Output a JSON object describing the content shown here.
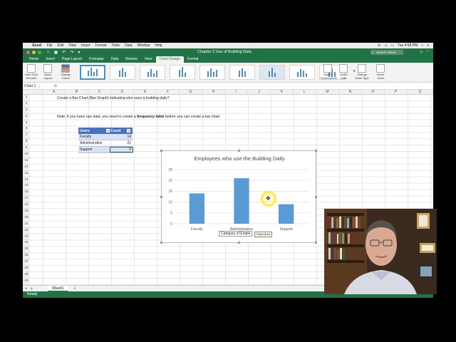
{
  "mac_menubar": {
    "app": "Excel",
    "menus": [
      "File",
      "Edit",
      "View",
      "Insert",
      "Format",
      "Tools",
      "Data",
      "Window",
      "Help"
    ],
    "clock": "Tue 4:58 PM"
  },
  "window": {
    "title": "Chapter 3 Use of Building Data",
    "search_placeholder": "Search Sheet"
  },
  "ribbon_tabs": [
    "Home",
    "Insert",
    "Page Layout",
    "Formulas",
    "Data",
    "Review",
    "View",
    "Chart Design",
    "Format"
  ],
  "active_tab": "Chart Design",
  "ribbon_buttons": {
    "add_chart_element": "Add Chart Element",
    "quick_layout": "Quick Layout",
    "change_colors": "Change Colors",
    "switch_row_column": "Switch Row/Column",
    "select_data": "Select Data",
    "change_chart_type": "Change Chart Type",
    "move_chart": "Move Chart"
  },
  "formula_bar": {
    "name_box": "Chart 1",
    "fx": "fx"
  },
  "columns": [
    "A",
    "B",
    "C",
    "D",
    "E",
    "F",
    "G",
    "H",
    "I",
    "J",
    "K",
    "L",
    "M",
    "N",
    "O",
    "P",
    "Q"
  ],
  "rows": [
    "1",
    "2",
    "3",
    "4",
    "5",
    "6",
    "7",
    "8",
    "9",
    "10",
    "11",
    "12",
    "13",
    "14",
    "15",
    "16",
    "17",
    "18",
    "19",
    "20",
    "21",
    "22",
    "23",
    "24",
    "25",
    "26",
    "27",
    "28",
    "29",
    "30"
  ],
  "sheet_text": {
    "row1": "Create a Bar Chart (Bar Graph) indicating who uses a building daily?",
    "row3_prefix": "Note: If you have raw data, you need to create a ",
    "row3_bold": "frequency table",
    "row3_suffix": " before you can create a bar chart."
  },
  "table": {
    "headers": [
      "Users",
      "Count"
    ],
    "rows": [
      {
        "label": "Faculty",
        "value": "14"
      },
      {
        "label": "Administrative",
        "value": "21"
      },
      {
        "label": "Support",
        "value": "9"
      }
    ]
  },
  "chart_data": {
    "type": "bar",
    "title": "Employees who use the Building Daily",
    "categories": [
      "Faculty",
      "Administrative",
      "Support"
    ],
    "values": [
      14,
      21,
      9
    ],
    "ylim": [
      0,
      25
    ],
    "yticks": [
      0,
      5,
      10,
      15,
      20,
      25
    ],
    "xlabel": "Category of Employee",
    "ylabel": "",
    "grid": true,
    "bar_color": "#5b9bd5"
  },
  "chart_ui": {
    "axis_title_visible": "Category of Emplo",
    "tooltip": "Chart Area"
  },
  "sheet_tabs": {
    "active": "Sheet1",
    "add": "+"
  },
  "status": "Ready",
  "colors": {
    "excel_green": "#217346",
    "table_header": "#4472c4"
  }
}
